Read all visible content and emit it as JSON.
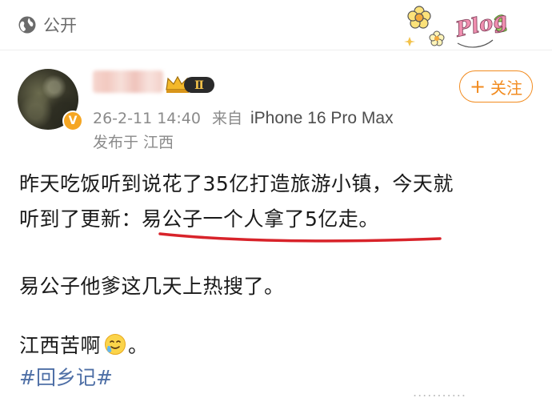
{
  "header": {
    "visibility_label": "公开",
    "visibility_icon": "globe-icon",
    "sticker_text": "Plog"
  },
  "user": {
    "member_level": "Ⅱ",
    "verified_badge": "V",
    "follow_label": "关注",
    "follow_icon": "+"
  },
  "post_meta": {
    "timestamp": "26-2-11 14:40",
    "from_label": "来自",
    "device": "iPhone 16 Pro Max",
    "location": "发布于 江西"
  },
  "content": {
    "line1": "昨天吃饭听到说花了35亿打造旅游小镇，今天就",
    "line2_prefix": "听到了更新：",
    "line2_underlined": "易公子一个人拿了5亿走。",
    "line3": "易公子他爹这几天上热搜了。",
    "line4_text": "江西苦啊",
    "line4_suffix": "。",
    "hashtag": "#回乡记#"
  },
  "watermark": "...........",
  "colors": {
    "accent": "#f28b1f",
    "hashtag": "#4e6fa6",
    "underline": "#d8232a",
    "meta_text": "#8a8a8a"
  }
}
